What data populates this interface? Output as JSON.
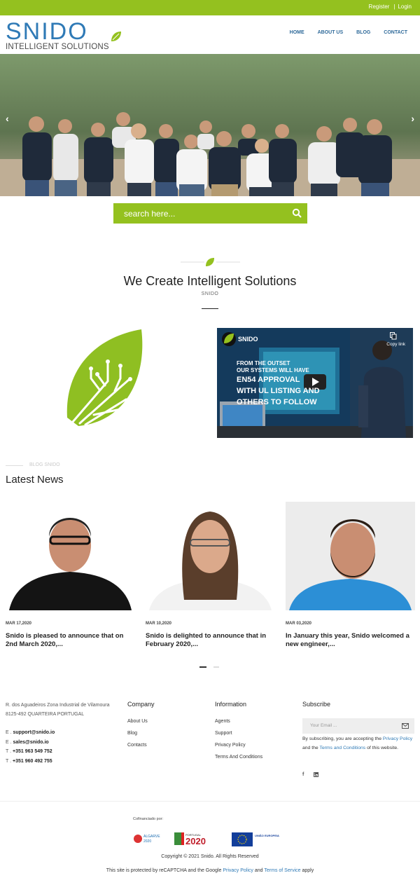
{
  "topbar": {
    "register": "Register",
    "separator": "|",
    "login": "Login"
  },
  "logo": {
    "word": "SNIDO",
    "subtitle": "INTELLIGENT SOLUTIONS"
  },
  "nav": [
    "HOME",
    "ABOUT US",
    "BLOG",
    "CONTACT"
  ],
  "hero": {
    "prev_icon": "chevron-left-icon",
    "next_icon": "chevron-right-icon"
  },
  "search": {
    "placeholder": "search here..."
  },
  "intro": {
    "title": "We Create Intelligent Solutions",
    "subtitle": "SNIDO"
  },
  "video": {
    "channel": "SNIDO",
    "copy_link": "Copy link",
    "line1": "FROM THE OUTSET",
    "line2": "OUR SYSTEMS WILL HAVE",
    "line3": "EN54 APPROVAL",
    "line4": "WITH UL LISTING AND",
    "line5": "OTHERS TO FOLLOW"
  },
  "news": {
    "kicker": "BLOG SNIDO",
    "heading": "Latest News",
    "items": [
      {
        "date": "MAR 17,2020",
        "title": "Snido is pleased to announce that on 2nd March 2020,..."
      },
      {
        "date": "MAR 10,2020",
        "title": "Snido is delighted to announce that in February 2020,..."
      },
      {
        "date": "MAR 03,2020",
        "title": "In January this year, Snido welcomed a new engineer,..."
      }
    ]
  },
  "footer": {
    "address": "R. dos Aguadeiros Zona Industrial de Vilamoura 8125-492 QUARTEIRA PORTUGAL",
    "contacts": [
      {
        "label": "E .",
        "value": "support@snido.io"
      },
      {
        "label": "E .",
        "value": "sales@snido.io"
      },
      {
        "label": "T .",
        "value": "+351 963 549 752"
      },
      {
        "label": "T .",
        "value": "+351 960 492 755"
      }
    ],
    "company": {
      "heading": "Company",
      "items": [
        "About Us",
        "Blog",
        "Contacts"
      ]
    },
    "information": {
      "heading": "Information",
      "items": [
        "Agents",
        "Support",
        "Privacy Policy",
        "Terms And Conditions"
      ]
    },
    "subscribe": {
      "heading": "Subscribe",
      "placeholder": "Your Email ...",
      "text1": "By subscribing, you are accepting the",
      "privacy": "Privacy Policy",
      "text2": "and the",
      "terms": "Terms and Conditions",
      "text3": "of this website."
    },
    "social": [
      "facebook-icon",
      "linkedin-icon"
    ],
    "cofinanciado": "Cofinanciado por:",
    "funding_logos": [
      "ALGARVE 2020",
      "PORTUGAL 2020",
      "UNIÃO EUROPEIA"
    ],
    "copyright": "Copyright © 2021 Snido. All Rights Reserved",
    "recaptcha": {
      "text1": "This site is protected by reCAPTCHA and the Google",
      "privacy": "Privacy Policy",
      "and": "and",
      "terms": "Terms of Service",
      "text2": "apply"
    }
  },
  "colors": {
    "brand_green": "#94c11f",
    "brand_blue": "#2f7ab6",
    "link_blue": "#2f7ab6"
  }
}
